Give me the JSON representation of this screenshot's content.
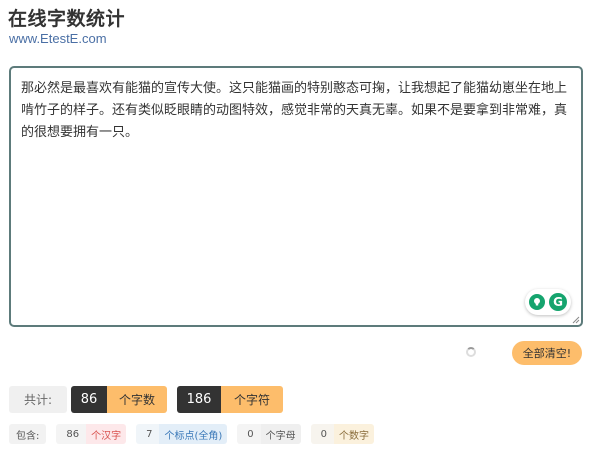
{
  "header": {
    "title": "在线字数统计",
    "subtitle": "www.EtestE.com"
  },
  "editor": {
    "text": "那必然是最喜欢有能猫的宣传大使。这只能猫画的特别憨态可掬，让我想起了能猫幼崽坐在地上啃竹子的样子。还有类似眨眼睛的动图特效，感觉非常的天真无辜。如果不是要拿到非常难，真的很想要拥有一只。"
  },
  "actions": {
    "clear_label": "全部清空!"
  },
  "stats": {
    "total_label": "共计:",
    "chars_count": "86",
    "chars_unit": "个字数",
    "symbols_count": "186",
    "symbols_unit": "个字符"
  },
  "details": {
    "label": "包含:",
    "hanzi_count": "86",
    "hanzi_unit": "个汉字",
    "punct_count": "7",
    "punct_unit": "个标点(全角)",
    "letter_count": "0",
    "letter_unit": "个字母",
    "digit_count": "0",
    "digit_unit": "个数字"
  },
  "colors": {
    "accent": "#fdbd6b",
    "dark": "#333333",
    "border": "#5d7b7b",
    "grammarly": "#15a46e"
  },
  "icons": {
    "bulb": "lightbulb-icon",
    "grammarly": "grammarly-icon",
    "spinner": "loading-spinner-icon",
    "resize": "resize-handle-icon"
  }
}
